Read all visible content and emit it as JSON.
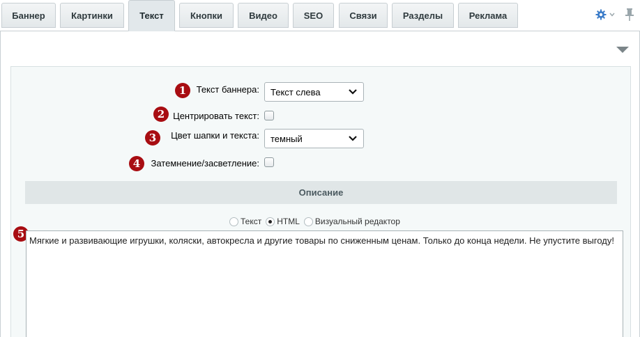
{
  "tabs": [
    {
      "label": "Баннер"
    },
    {
      "label": "Картинки"
    },
    {
      "label": "Текст",
      "active": true
    },
    {
      "label": "Кнопки"
    },
    {
      "label": "Видео"
    },
    {
      "label": "SEO"
    },
    {
      "label": "Связи"
    },
    {
      "label": "Разделы"
    },
    {
      "label": "Реклама"
    }
  ],
  "toolbar": {
    "gear_icon": "gear-icon",
    "pin_icon": "pin-icon",
    "accent_color": "#3a7bc8"
  },
  "form": {
    "banner_text": {
      "badge": "1",
      "label": "Текст баннера:",
      "value": "Текст слева"
    },
    "center_text": {
      "badge": "2",
      "label": "Центрировать текст:",
      "checked": false
    },
    "header_color": {
      "badge": "3",
      "label": "Цвет шапки и текста:",
      "value": "темный"
    },
    "dimming": {
      "badge": "4",
      "label": "Затемнение/засветление:",
      "checked": false
    }
  },
  "description": {
    "heading": "Описание",
    "modes": [
      {
        "label": "Текст",
        "checked": false
      },
      {
        "label": "HTML",
        "checked": true
      },
      {
        "label": "Визуальный редактор",
        "checked": false
      }
    ],
    "badge": "5",
    "content": "Мягкие и развивающие игрушки, коляски, автокресла и другие товары по сниженным ценам. Только до конца недели. Не упустите выгоду!"
  },
  "colors": {
    "badge": "#a80d12",
    "panel_bg": "#f5f9f9",
    "section_head_bg": "#e0e6e7"
  }
}
